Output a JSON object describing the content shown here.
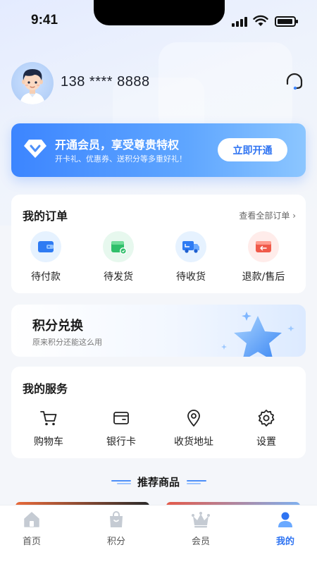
{
  "status_bar": {
    "time": "9:41"
  },
  "profile": {
    "phone": "138 **** 8888"
  },
  "vip_banner": {
    "title": "开通会员，享受尊贵特权",
    "subtitle": "开卡礼、优惠券、送积分等多重好礼！",
    "button": "立即开通"
  },
  "orders": {
    "title": "我的订单",
    "view_all": "查看全部订单 ›",
    "items": [
      {
        "label": "待付款",
        "icon": "wallet-icon"
      },
      {
        "label": "待发货",
        "icon": "package-icon"
      },
      {
        "label": "待收货",
        "icon": "truck-icon"
      },
      {
        "label": "退款/售后",
        "icon": "refund-icon"
      }
    ]
  },
  "points_exchange": {
    "title": "积分兑换",
    "subtitle": "原来积分还能这么用"
  },
  "services": {
    "title": "我的服务",
    "items": [
      {
        "label": "购物车",
        "icon": "cart-icon"
      },
      {
        "label": "银行卡",
        "icon": "bank-card-icon"
      },
      {
        "label": "收货地址",
        "icon": "location-icon"
      },
      {
        "label": "设置",
        "icon": "gear-icon"
      }
    ]
  },
  "recommend": {
    "title": "推荐商品"
  },
  "tabbar": {
    "items": [
      {
        "label": "首页",
        "icon": "home-icon",
        "active": false
      },
      {
        "label": "积分",
        "icon": "shopping-bag-icon",
        "active": false
      },
      {
        "label": "会员",
        "icon": "crown-icon",
        "active": false
      },
      {
        "label": "我的",
        "icon": "user-icon",
        "active": true
      }
    ]
  },
  "colors": {
    "accent": "#2f74f2",
    "vip_start": "#3c85ff",
    "vip_end": "#8cc6ff"
  }
}
